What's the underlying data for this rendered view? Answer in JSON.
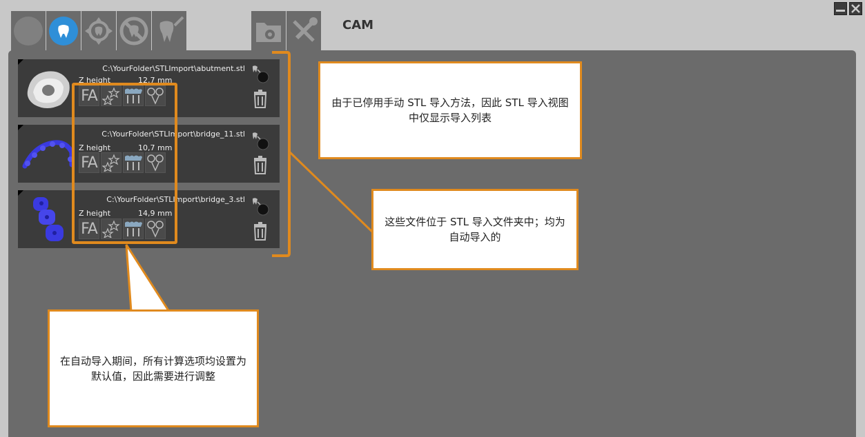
{
  "app": {
    "title": "CAM"
  },
  "tabs": [
    {
      "icon": "circle-icon",
      "active": false
    },
    {
      "icon": "tooth-icon",
      "active": true
    },
    {
      "icon": "move-arrows-icon",
      "active": false
    },
    {
      "icon": "no-tooth-icon",
      "active": false
    },
    {
      "icon": "tooth-wand-icon",
      "active": false
    },
    {
      "icon": "folder-gear-icon",
      "active": false
    },
    {
      "icon": "tools-icon",
      "active": false
    }
  ],
  "window_controls": {
    "minimize_icon": "minimize-icon",
    "close_icon": "close-icon"
  },
  "import_list": {
    "z_label": "Z height",
    "items": [
      {
        "path": "C:\\YourFolder\\STLImport\\abutment.stl",
        "z_height": "12,7 mm",
        "fa_label": "FA",
        "thumb": "abutment"
      },
      {
        "path": "C:\\YourFolder\\STLImport\\bridge_11.stl",
        "z_height": "10,7 mm",
        "fa_label": "FA",
        "thumb": "bridge-arch"
      },
      {
        "path": "C:\\YourFolder\\STLImport\\bridge_3.stl",
        "z_height": "14,9 mm",
        "fa_label": "FA",
        "thumb": "bridge-short"
      }
    ]
  },
  "callouts": {
    "manual_disabled": "由于已停用手动 STL 导入方法，因此 STL 导入视图中仅显示导入列表",
    "auto_import": "这些文件位于 STL 导入文件夹中；均为自动导入的",
    "defaults": "在自动导入期间，所有计算选项均设置为默认值，因此需要进行调整"
  },
  "colors": {
    "accent": "#e08a1e",
    "active_tab": "#2f8fd8",
    "model_blue": "#3a3ae0"
  }
}
